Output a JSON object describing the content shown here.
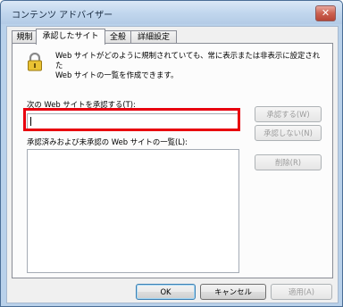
{
  "window": {
    "title": "コンテンツ アドバイザー",
    "close_symbol": "✕"
  },
  "tabs": [
    {
      "label": "規制"
    },
    {
      "label": "承認したサイト"
    },
    {
      "label": "全般"
    },
    {
      "label": "詳細設定"
    }
  ],
  "approved_sites": {
    "description_line1": "Web サイトがどのように規制されていても、常に表示または非表示に設定された",
    "description_line2": "Web サイトの一覧を作成できます。",
    "url_label": "次の Web サイトを承認する(T):",
    "url_value": "",
    "list_label": "承認済みおよび未承認の Web サイトの一覧(L):",
    "approve_button": "承認する(W)",
    "disapprove_button": "承認しない(N)",
    "delete_button": "削除(R)"
  },
  "footer": {
    "ok": "OK",
    "cancel": "キャンセル",
    "apply": "適用(A)"
  },
  "colors": {
    "highlight": "#e8000e"
  }
}
